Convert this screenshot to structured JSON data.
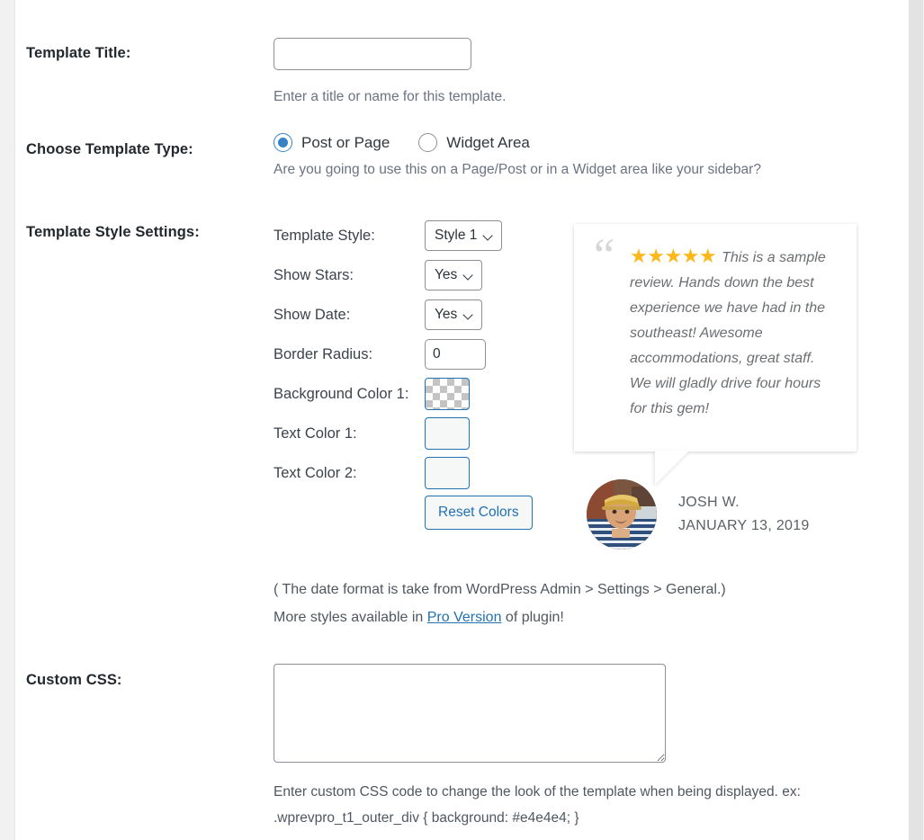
{
  "form": {
    "rows": [
      {
        "label": "Template Title:",
        "input_value": "",
        "description": "Enter a title or name for this template."
      },
      {
        "label": "Choose Template Type:",
        "options": [
          {
            "label": "Post or Page",
            "checked": true
          },
          {
            "label": "Widget Area",
            "checked": false
          }
        ],
        "description": "Are you going to use this on a Page/Post or in a Widget area like your sidebar?"
      },
      {
        "label": "Template Style Settings:"
      },
      {
        "label": "Custom CSS:"
      }
    ]
  },
  "style_settings": {
    "template_style": {
      "label": "Template Style:",
      "value": "Style 1"
    },
    "show_stars": {
      "label": "Show Stars:",
      "value": "Yes"
    },
    "show_date": {
      "label": "Show Date:",
      "value": "Yes"
    },
    "border_radius": {
      "label": "Border Radius:",
      "value": "0"
    },
    "background_color_1": {
      "label": "Background Color 1:",
      "value": "transparent"
    },
    "text_color_1": {
      "label": "Text Color 1:",
      "value": ""
    },
    "text_color_2": {
      "label": "Text Color 2:",
      "value": ""
    },
    "reset_button": "Reset Colors"
  },
  "preview": {
    "stars": "★★★★★",
    "star_count": 5,
    "quote_glyph": "“",
    "review_text": "This is a sample review. Hands down the best experience we have had in the southeast! Awesome accommodations, great staff. We will gladly drive four hours for this gem!",
    "author_name": "JOSH W.",
    "author_date": "JANUARY 13, 2019",
    "colors": {
      "star": "#fcb71b",
      "text": "#6b6f72",
      "quote": "#d6d6d6"
    }
  },
  "notes": {
    "date_format_note": "( The date format is take from WordPress Admin > Settings > General.)",
    "pro_prefix": "More styles available in ",
    "pro_link": "Pro Version",
    "pro_suffix": " of plugin!"
  },
  "custom_css": {
    "value": "",
    "description_line1": "Enter custom CSS code to change the look of the template when being displayed. ex:",
    "description_line2": ".wprevpro_t1_outer_div { background: #e4e4e4; }"
  }
}
